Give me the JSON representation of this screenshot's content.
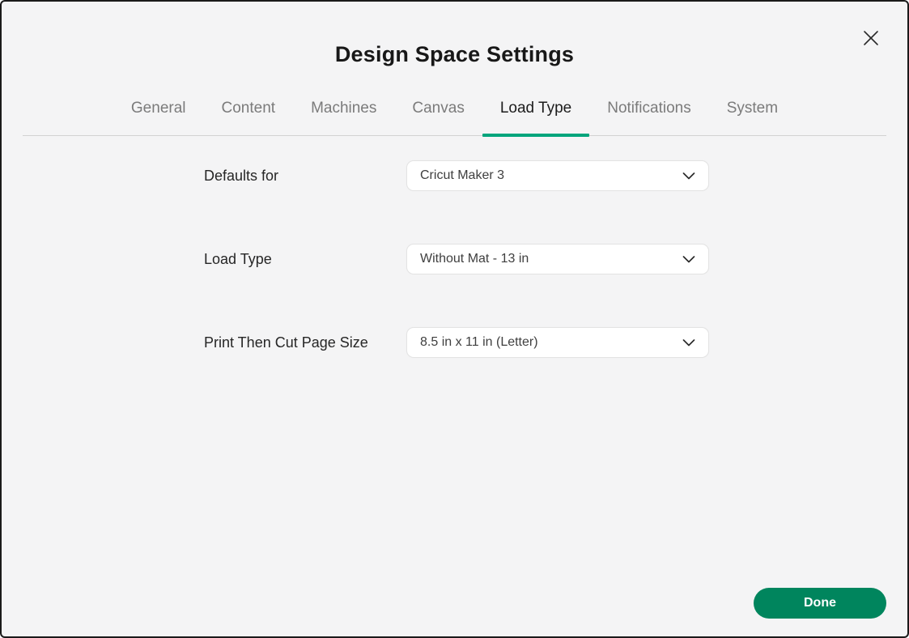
{
  "dialog": {
    "title": "Design Space Settings"
  },
  "icons": {
    "close": "close-icon",
    "chevron": "chevron-down-icon"
  },
  "tabs": [
    {
      "label": "General",
      "active": false
    },
    {
      "label": "Content",
      "active": false
    },
    {
      "label": "Machines",
      "active": false
    },
    {
      "label": "Canvas",
      "active": false
    },
    {
      "label": "Load Type",
      "active": true
    },
    {
      "label": "Notifications",
      "active": false
    },
    {
      "label": "System",
      "active": false
    }
  ],
  "settings": [
    {
      "label": "Defaults for",
      "value": "Cricut Maker 3"
    },
    {
      "label": "Load Type",
      "value": "Without Mat - 13 in"
    },
    {
      "label": "Print Then Cut Page Size",
      "value": "8.5 in x 11 in (Letter)"
    }
  ],
  "footer": {
    "done_label": "Done"
  },
  "colors": {
    "accent_green": "#00a57c",
    "button_green": "#00855d",
    "background": "#f4f4f5"
  }
}
